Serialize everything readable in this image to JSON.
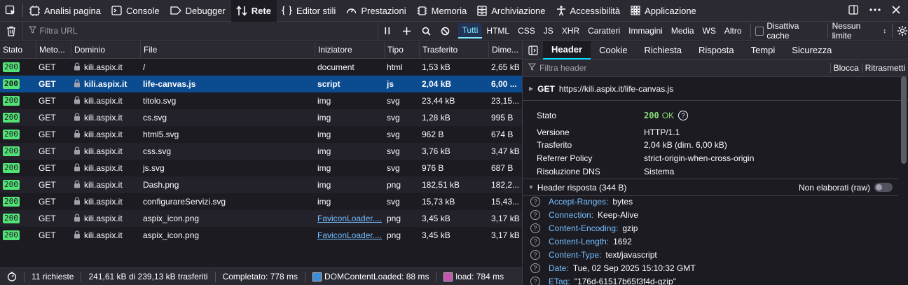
{
  "toolbar": {
    "tabs": [
      {
        "label": "Analisi pagina",
        "icon": "inspector-icon"
      },
      {
        "label": "Console",
        "icon": "console-icon"
      },
      {
        "label": "Debugger",
        "icon": "debugger-icon"
      },
      {
        "label": "Rete",
        "icon": "network-icon",
        "active": true
      },
      {
        "label": "Editor stili",
        "icon": "style-editor-icon"
      },
      {
        "label": "Prestazioni",
        "icon": "performance-icon"
      },
      {
        "label": "Memoria",
        "icon": "memory-icon"
      },
      {
        "label": "Archiviazione",
        "icon": "storage-icon"
      },
      {
        "label": "Accessibilità",
        "icon": "accessibility-icon"
      },
      {
        "label": "Applicazione",
        "icon": "application-icon"
      }
    ]
  },
  "filterbar": {
    "placeholder": "Filtra URL",
    "types": [
      "Tutti",
      "HTML",
      "CSS",
      "JS",
      "XHR",
      "Caratteri",
      "Immagini",
      "Media",
      "WS",
      "Altro"
    ],
    "active_type": "Tutti",
    "disable_cache": "Disattiva cache",
    "throttle": "Nessun limite"
  },
  "table": {
    "columns": [
      "Stato",
      "Meto...",
      "Dominio",
      "File",
      "Iniziatore",
      "Tipo",
      "Trasferito",
      "Dime..."
    ],
    "rows": [
      {
        "status": "200",
        "method": "GET",
        "domain": "kili.aspix.it",
        "file": "/",
        "initiator": "document",
        "type": "html",
        "transferred": "1,53 kB",
        "size": "2,65 kB"
      },
      {
        "status": "200",
        "method": "GET",
        "domain": "kili.aspix.it",
        "file": "life-canvas.js",
        "initiator": "script",
        "type": "js",
        "transferred": "2,04 kB",
        "size": "6,00 ...",
        "selected": true
      },
      {
        "status": "200",
        "method": "GET",
        "domain": "kili.aspix.it",
        "file": "titolo.svg",
        "initiator": "img",
        "type": "svg",
        "transferred": "23,44 kB",
        "size": "23,15..."
      },
      {
        "status": "200",
        "method": "GET",
        "domain": "kili.aspix.it",
        "file": "cs.svg",
        "initiator": "img",
        "type": "svg",
        "transferred": "1,28 kB",
        "size": "995 B"
      },
      {
        "status": "200",
        "method": "GET",
        "domain": "kili.aspix.it",
        "file": "html5.svg",
        "initiator": "img",
        "type": "svg",
        "transferred": "962 B",
        "size": "674 B"
      },
      {
        "status": "200",
        "method": "GET",
        "domain": "kili.aspix.it",
        "file": "css.svg",
        "initiator": "img",
        "type": "svg",
        "transferred": "3,76 kB",
        "size": "3,47 kB"
      },
      {
        "status": "200",
        "method": "GET",
        "domain": "kili.aspix.it",
        "file": "js.svg",
        "initiator": "img",
        "type": "svg",
        "transferred": "976 B",
        "size": "687 B"
      },
      {
        "status": "200",
        "method": "GET",
        "domain": "kili.aspix.it",
        "file": "Dash.png",
        "initiator": "img",
        "type": "png",
        "transferred": "182,51 kB",
        "size": "182,2..."
      },
      {
        "status": "200",
        "method": "GET",
        "domain": "kili.aspix.it",
        "file": "configurareServizi.svg",
        "initiator": "img",
        "type": "svg",
        "transferred": "15,73 kB",
        "size": "15,43..."
      },
      {
        "status": "200",
        "method": "GET",
        "domain": "kili.aspix.it",
        "file": "aspix_icon.png",
        "initiator": "FaviconLoader....",
        "type": "png",
        "transferred": "3,45 kB",
        "size": "3,17 kB",
        "initiator_link": true
      },
      {
        "status": "200",
        "method": "GET",
        "domain": "kili.aspix.it",
        "file": "aspix_icon.png",
        "initiator": "FaviconLoader....",
        "type": "png",
        "transferred": "3,45 kB",
        "size": "3,17 kB",
        "initiator_link": true
      }
    ]
  },
  "statusbar": {
    "requests": "11 richieste",
    "transferred": "241,61 kB di 239,13 kB trasferiti",
    "completed": "Completato: 778 ms",
    "dcl": "DOMContentLoaded: 88 ms",
    "load": "load: 784 ms"
  },
  "details": {
    "tabs": [
      "Header",
      "Cookie",
      "Richiesta",
      "Risposta",
      "Tempi",
      "Sicurezza"
    ],
    "active_tab": "Header",
    "filter_placeholder": "Filtra header",
    "block_label": "Blocca",
    "resend_label": "Ritrasmetti",
    "method": "GET",
    "url": "https://kili.aspix.it/life-canvas.js",
    "summary": [
      {
        "key": "Stato",
        "value": "200",
        "value_extra": "OK"
      },
      {
        "key": "Versione",
        "value": "HTTP/1.1"
      },
      {
        "key": "Trasferito",
        "value": "2,04 kB (dim. 6,00 kB)"
      },
      {
        "key": "Referrer Policy",
        "value": "strict-origin-when-cross-origin"
      },
      {
        "key": "Risoluzione DNS",
        "value": "Sistema"
      }
    ],
    "response_section": "Header risposta (344 B)",
    "raw_label": "Non elaborati (raw)",
    "response_headers": [
      {
        "name": "Accept-Ranges:",
        "value": "bytes"
      },
      {
        "name": "Connection:",
        "value": "Keep-Alive"
      },
      {
        "name": "Content-Encoding:",
        "value": "gzip"
      },
      {
        "name": "Content-Length:",
        "value": "1692"
      },
      {
        "name": "Content-Type:",
        "value": "text/javascript"
      },
      {
        "name": "Date:",
        "value": "Tue, 02 Sep 2025 15:10:32 GMT"
      },
      {
        "name": "ETag:",
        "value": "\"176d-61517b65f3f4d-gzip\""
      }
    ]
  },
  "colors": {
    "status_ok": "#52e276",
    "selected_row": "#0b4c90",
    "link": "#75bfff",
    "dcl_swatch": "#3c8dd6",
    "load_swatch": "#c455b0"
  }
}
